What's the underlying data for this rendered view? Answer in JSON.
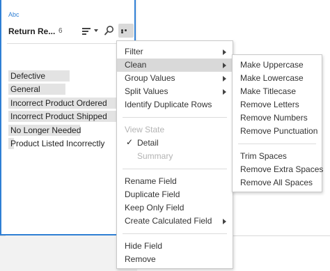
{
  "card": {
    "type_label": "Abc",
    "field_name": "Return Re...",
    "count": "6"
  },
  "values": [
    {
      "label": "Defective",
      "share": 0.56
    },
    {
      "label": "General",
      "share": 0.52
    },
    {
      "label": "Incorrect Product Ordered",
      "share": 1.0
    },
    {
      "label": "Incorrect Product Shipped",
      "share": 1.0
    },
    {
      "label": "No Longer Needed",
      "share": 0.65
    },
    {
      "label": "Product Listed Incorrectly",
      "share": 0.05
    }
  ],
  "menu": {
    "filter": "Filter",
    "clean": "Clean",
    "group_values": "Group Values",
    "split_values": "Split Values",
    "identify_duplicates": "Identify Duplicate Rows",
    "view_state": "View State",
    "detail": "Detail",
    "detail_check": "✓",
    "summary": "Summary",
    "rename": "Rename Field",
    "duplicate": "Duplicate Field",
    "keep_only": "Keep Only Field",
    "create_calc": "Create Calculated Field",
    "hide": "Hide Field",
    "remove": "Remove"
  },
  "submenu": {
    "make_uppercase": "Make Uppercase",
    "make_lowercase": "Make Lowercase",
    "make_titlecase": "Make Titlecase",
    "remove_letters": "Remove Letters",
    "remove_numbers": "Remove Numbers",
    "remove_punctuation": "Remove Punctuation",
    "trim_spaces": "Trim Spaces",
    "remove_extra_spaces": "Remove Extra Spaces",
    "remove_all_spaces": "Remove All Spaces"
  },
  "colors": {
    "accent": "#2f7fd4",
    "highlight": "#d9d9d9",
    "bar": "#e3e3e3",
    "disabled_text": "#b3b3b3"
  },
  "icons": [
    "sort-icon",
    "search-icon",
    "more-options-icon",
    "submenu-arrow-icon",
    "checkmark-icon"
  ]
}
